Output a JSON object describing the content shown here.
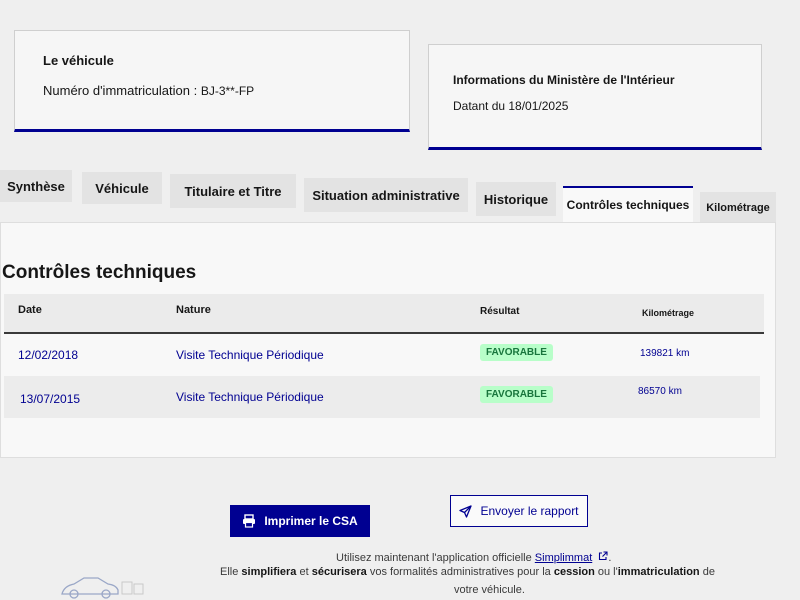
{
  "vehicle_card": {
    "title": "Le véhicule",
    "plate_label": "Numéro d'immatriculation :",
    "plate_value": "BJ-3**-FP"
  },
  "ministry_card": {
    "title": "Informations du Ministère de l'Intérieur",
    "date_text": "Datant du 18/01/2025"
  },
  "tabs": [
    {
      "label": "Synthèse"
    },
    {
      "label": "Véhicule"
    },
    {
      "label": "Titulaire et Titre"
    },
    {
      "label": "Situation administrative"
    },
    {
      "label": "Historique"
    },
    {
      "label": "Contrôles techniques",
      "active": true
    },
    {
      "label": "Kilométrage"
    }
  ],
  "section": {
    "title": "Contrôles techniques",
    "columns": [
      "Date",
      "Nature",
      "Résultat",
      "Kilométrage"
    ],
    "rows": [
      {
        "date": "12/02/2018",
        "nature": "Visite Technique Périodique",
        "result": "FAVORABLE",
        "km": "139821 km"
      },
      {
        "date": "13/07/2015",
        "nature": "Visite Technique Périodique",
        "result": "FAVORABLE",
        "km": "86570 km"
      }
    ]
  },
  "actions": {
    "print_label": "Imprimer le CSA",
    "send_label": "Envoyer le rapport"
  },
  "footer": {
    "line1_prefix": "Utilisez maintenant l'application officielle",
    "line1_link": "Simplimmat",
    "line1_suffix": ".",
    "line2_a": "Elle ",
    "line2_b": "simplifiera",
    "line2_c": " et ",
    "line2_d": "sécurisera",
    "line2_e": " vos formalités administratives pour la ",
    "line2_f": "cession",
    "line2_g": " ou l'",
    "line2_h": "immatriculation",
    "line2_i": " de",
    "line3": "votre véhicule."
  },
  "colors": {
    "primary": "#000091",
    "success_bg": "#b8fec9",
    "success_text": "#18753c"
  },
  "icons": {
    "print": "printer-icon",
    "send": "paper-plane-icon",
    "external": "external-link-icon"
  }
}
